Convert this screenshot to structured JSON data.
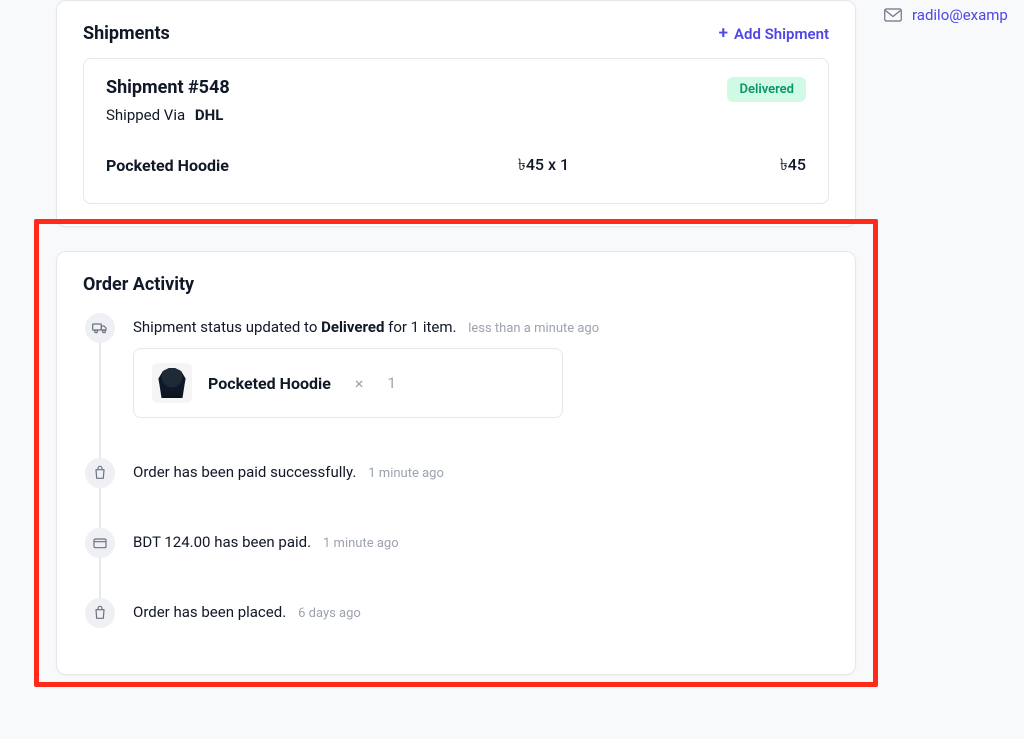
{
  "sidebar": {
    "customer_email": "radilo@examp"
  },
  "shipments_card": {
    "title": "Shipments",
    "add_label": "Add Shipment",
    "shipment": {
      "title": "Shipment #548",
      "via_label": "Shipped Via",
      "carrier": "DHL",
      "status_badge": "Delivered",
      "item": {
        "name": "Pocketed Hoodie",
        "unit_qty": "৳45 x 1",
        "total": "৳45"
      }
    }
  },
  "activity_card": {
    "title": "Order Activity",
    "items": [
      {
        "text_prefix": "Shipment status updated to ",
        "text_strong": "Delivered",
        "text_suffix": " for 1 item.",
        "time": "less than a minute ago",
        "product": {
          "name": "Pocketed Hoodie",
          "qty": "1"
        }
      },
      {
        "text": "Order has been paid successfully.",
        "time": "1 minute ago"
      },
      {
        "text": "BDT 124.00 has been paid.",
        "time": "1 minute ago"
      },
      {
        "text": "Order has been placed.",
        "time": "6 days ago"
      }
    ]
  }
}
